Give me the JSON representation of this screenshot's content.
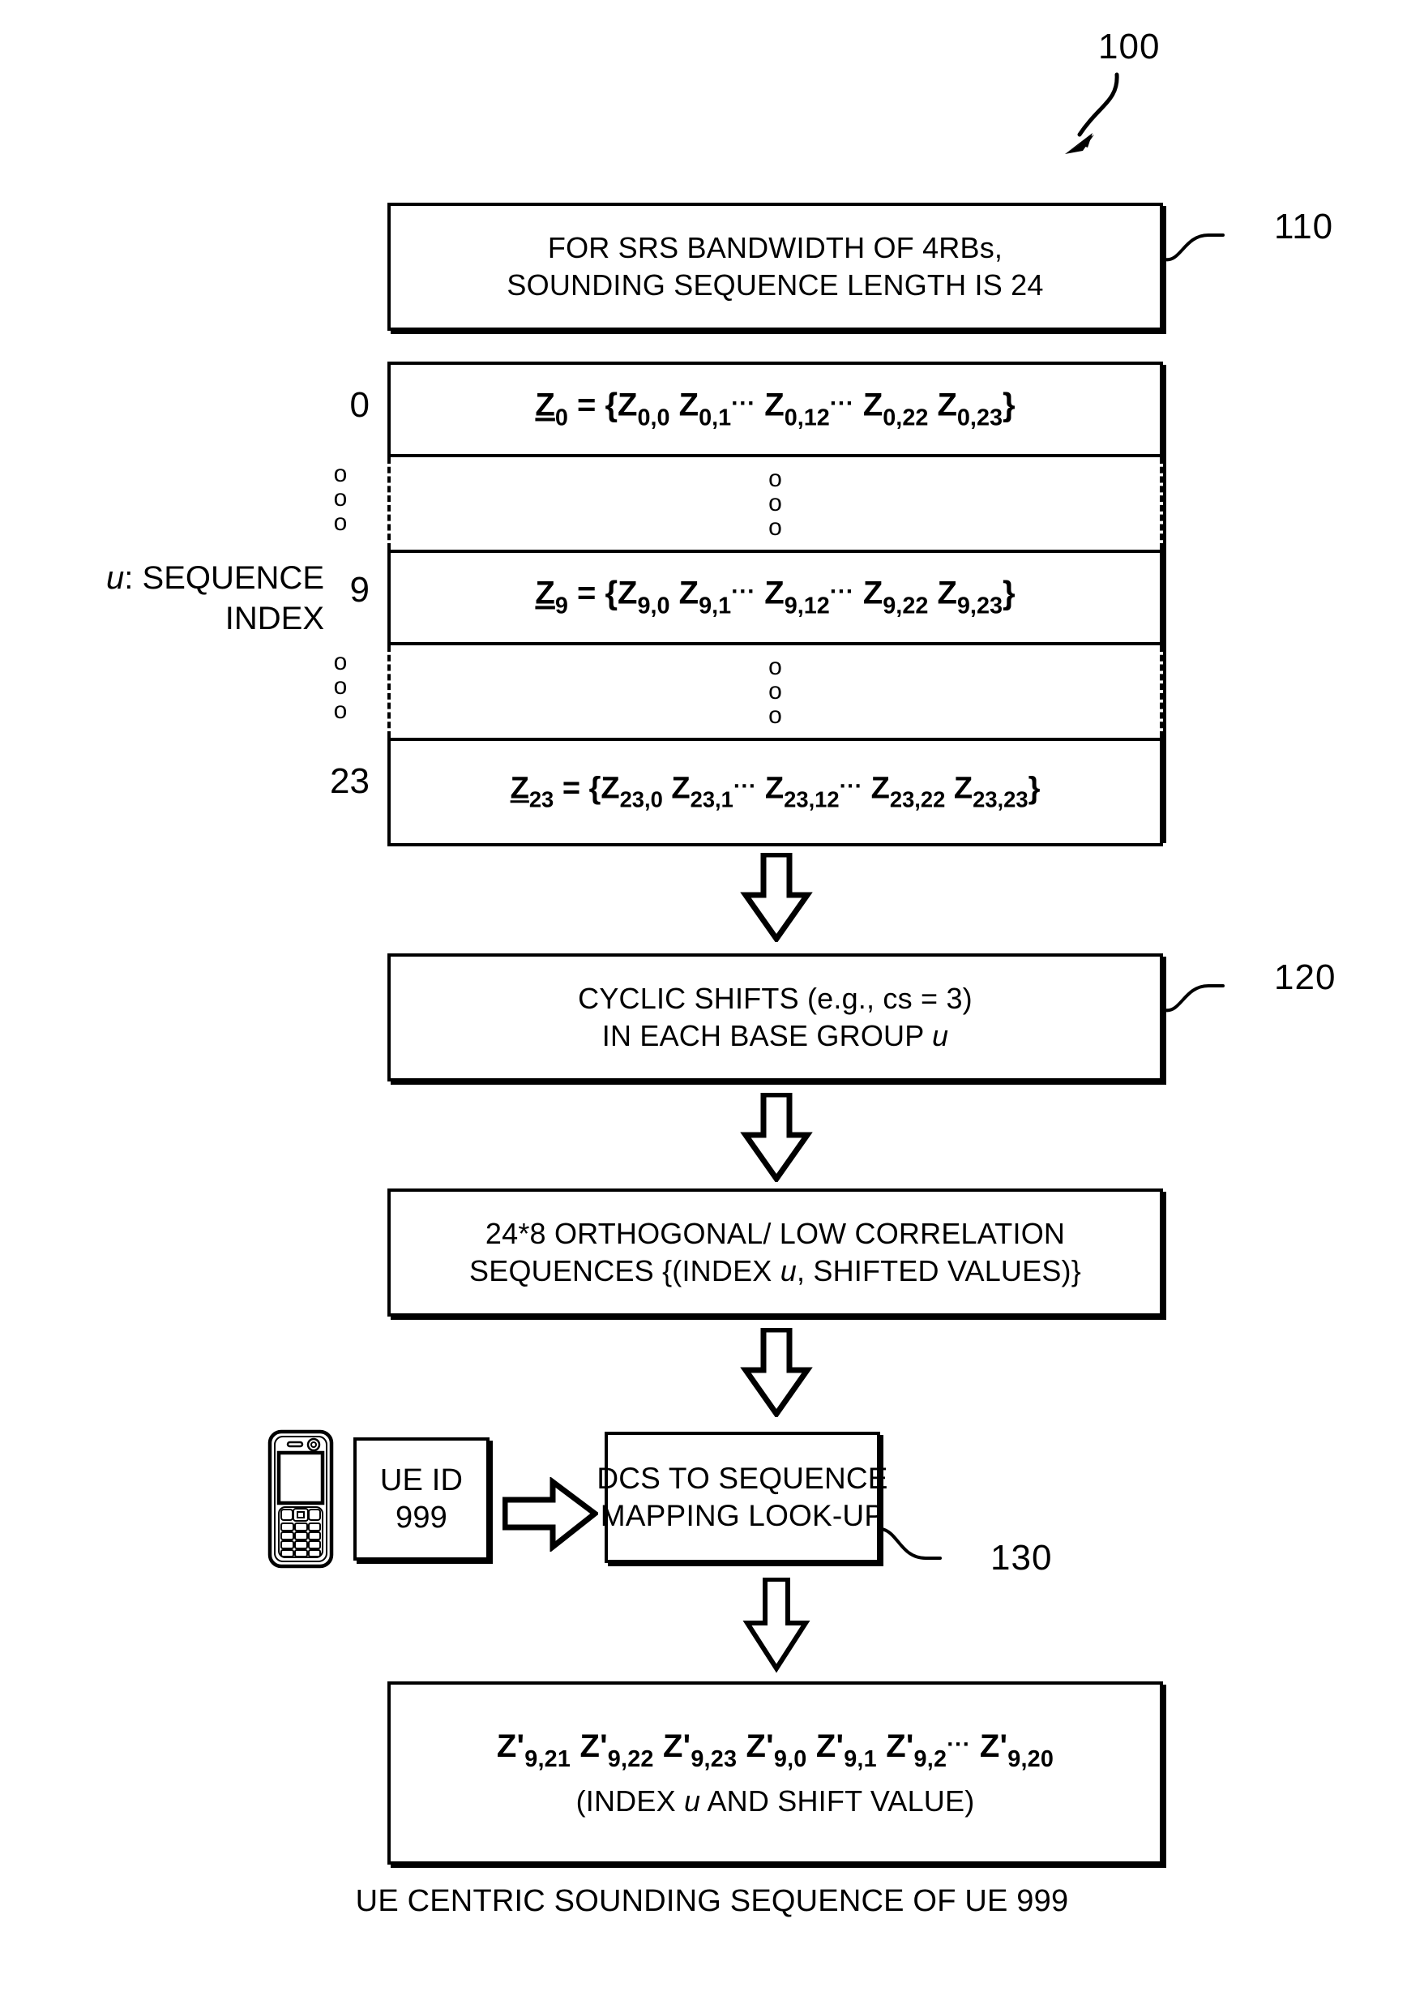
{
  "figure": {
    "number": "100",
    "caption": "UE CENTRIC SOUNDING SEQUENCE OF UE 999"
  },
  "refs": {
    "fig": "100",
    "box110": "110",
    "box120": "120",
    "box130": "130"
  },
  "box110": {
    "line1": "FOR SRS BANDWIDTH OF 4RBs,",
    "line2": "SOUNDING SEQUENCE LENGTH IS 24"
  },
  "matrix": {
    "axis_label_line1": "u: SEQUENCE",
    "axis_label_line2": "INDEX",
    "axis_symbol": "u",
    "ellipsis_glyph": "o",
    "rows": [
      {
        "index": "0",
        "type": "sequence",
        "vector": "Z",
        "vector_sub": "0",
        "equals": "= {",
        "close": "}",
        "elements": [
          "Z",
          "0,0",
          "Z",
          "0,1",
          "Z",
          "0,12",
          "Z",
          "0,22",
          "Z",
          "0,23"
        ],
        "text": "Z0 = {Z0,0 Z0,1... Z0,12... Z0,22 Z0,23}"
      },
      {
        "index": "",
        "type": "ellipsis",
        "text": "o o o"
      },
      {
        "index": "9",
        "type": "sequence",
        "vector": "Z",
        "vector_sub": "9",
        "equals": "= {",
        "close": "}",
        "elements": [
          "Z",
          "9,0",
          "Z",
          "9,1",
          "Z",
          "9,12",
          "Z",
          "9,22",
          "Z",
          "9,23"
        ],
        "text": "Z9 = {Z9,0 Z9,1... Z9,12... Z9,22 Z9,23}"
      },
      {
        "index": "",
        "type": "ellipsis",
        "text": "o o o"
      },
      {
        "index": "23",
        "type": "sequence",
        "vector": "Z",
        "vector_sub": "23",
        "equals": "= {",
        "close": "}",
        "elements": [
          "Z",
          "23,0",
          "Z",
          "23,1",
          "Z",
          "23,12",
          "Z",
          "23,22",
          "Z",
          "23,23"
        ],
        "text": "Z23 = {Z23,0 Z23,1... Z23,12... Z23,22 Z23,23}"
      }
    ]
  },
  "box120": {
    "line1": "CYCLIC SHIFTS (e.g., cs = 3)",
    "line2_pre": "IN EACH BASE GROUP ",
    "line2_sym": "u"
  },
  "box125": {
    "line1": "24*8 ORTHOGONAL/ LOW CORRELATION",
    "line2_pre": "SEQUENCES {(INDEX ",
    "line2_sym": "u",
    "line2_post": ", SHIFTED VALUES)}"
  },
  "ue": {
    "device_icon": "mobile-phone-icon",
    "id_label": "UE ID",
    "id_value": "999"
  },
  "box130": {
    "line1": "DCS TO SEQUENCE",
    "line2": "MAPPING LOOK-UP"
  },
  "output": {
    "elements": [
      {
        "base": "Z'",
        "sub": "9,21"
      },
      {
        "base": "Z'",
        "sub": "9,22"
      },
      {
        "base": "Z'",
        "sub": "9,23"
      },
      {
        "base": "Z'",
        "sub": "9,0"
      },
      {
        "base": "Z'",
        "sub": "9,1"
      },
      {
        "base": "Z'",
        "sub": "9,2"
      },
      {
        "base": "Z'",
        "sub": "9,20"
      }
    ],
    "ellipsis": "...",
    "line2_pre": "(INDEX ",
    "line2_sym": "u",
    "line2_post": " AND SHIFT VALUE)",
    "text": "Z'9,21 Z'9,22 Z'9,23 Z'9,0 Z'9,1 Z'9,2... Z'9,20"
  },
  "colors": {
    "ink": "#000000",
    "paper": "#ffffff"
  }
}
